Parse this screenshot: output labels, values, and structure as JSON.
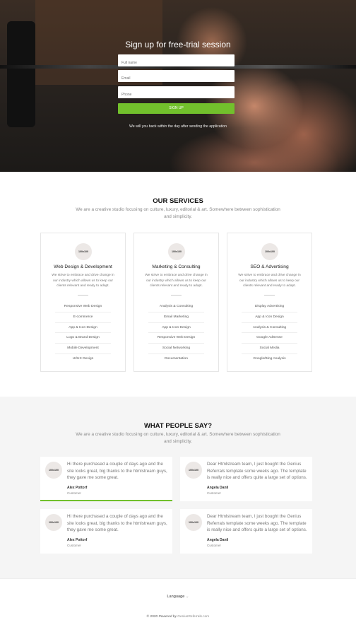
{
  "hero": {
    "title": "Sign up for free-trial session",
    "fields": [
      {
        "placeholder": "Full name"
      },
      {
        "placeholder": "Email"
      },
      {
        "placeholder": "Phone"
      }
    ],
    "submit_label": "SIGN UP",
    "note": "We will you back within the day after sending the application"
  },
  "services": {
    "title": "OUR SERVICES",
    "description": "We are a creative studio focusing on culture, luxury, editorial & art. Somewhere between sophistication and simplicity.",
    "items": [
      {
        "avatar": "100x100",
        "name": "Web Design & Development",
        "text": "We strive to embrace and drive change in our industry which allows us to keep our clients relevant and ready to adapt.",
        "list": [
          "Responsive Web Design",
          "E-commerce",
          "App & Icon Design",
          "Logo & Brand Design",
          "Mobile Development",
          "UI/UX Design"
        ]
      },
      {
        "avatar": "100x100",
        "name": "Marketing & Consulting",
        "text": "We strive to embrace and drive change in our industry which allows us to keep our clients relevant and ready to adapt.",
        "list": [
          "Analysis & Consulting",
          "Email Marketing",
          "App & Icon Design",
          "Responsive Web Design",
          "Social Networking",
          "Documentation"
        ]
      },
      {
        "avatar": "100x100",
        "name": "SEO & Advertising",
        "text": "We strive to embrace and drive change in our industry which allows us to keep our clients relevant and ready to adapt.",
        "list": [
          "Display Advertising",
          "App & Icon Design",
          "Analysis & Consulting",
          "Google AdSense",
          "Social Media",
          "Google/Bing Analysis"
        ]
      }
    ]
  },
  "testimonials": {
    "title": "WHAT PEOPLE SAY?",
    "description": "We are a creative studio focusing on culture, luxury, editorial & art. Somewhere between sophistication and simplicity.",
    "items": [
      {
        "avatar": "100x100",
        "quote": "Hi there purchased a couple of days ago and the site looks great, big thanks to the htmlstream guys, they gave me some great.",
        "author": "Alex Pottorf",
        "role": "Customer"
      },
      {
        "avatar": "100x100",
        "quote": "Dear Htmlstream team, I just bought the Genius Referrals template some weeks ago. The template is really nice and offers quite a large set of options.",
        "author": "Angela Danil",
        "role": "Customer"
      },
      {
        "avatar": "100x100",
        "quote": "Hi there purchased a couple of days ago and the site looks great, big thanks to the htmlstream guys, they gave me some great.",
        "author": "Alex Pottorf",
        "role": "Customer"
      },
      {
        "avatar": "100x100",
        "quote": "Dear Htmlstream team, I just bought the Genius Referrals template some weeks ago. The template is really nice and offers quite a large set of options.",
        "author": "Angela Danil",
        "role": "Customer"
      }
    ]
  },
  "footer": {
    "language_label": "Language",
    "chevron_glyph": "⌄",
    "copyright_prefix": "© 2020",
    "powered_by": "Powered by",
    "link_text": "GeniusReferrals.com"
  },
  "colors": {
    "accent": "#72c02c"
  }
}
